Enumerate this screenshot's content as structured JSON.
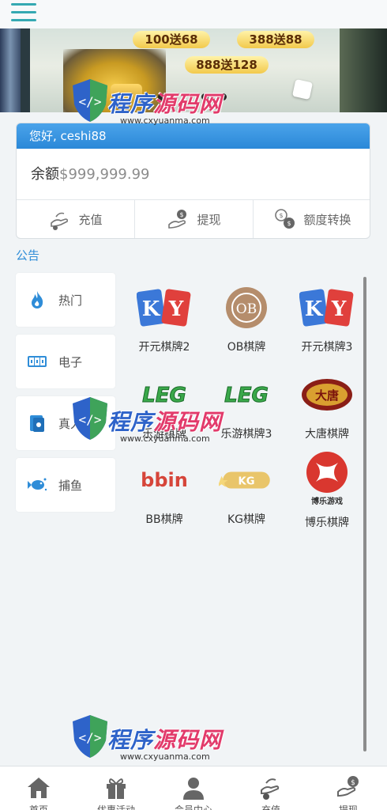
{
  "topbar": {
    "menu_icon": "hamburger-menu-icon"
  },
  "banner": {
    "promos": [
      "100送68",
      "388送88",
      "888送128"
    ],
    "slide_count": 3,
    "active_slide": 1
  },
  "account": {
    "greeting": "您好, ceshi88",
    "balance_label": "余额",
    "balance_value": "$999,999.99",
    "actions": [
      {
        "label": "充值",
        "icon": "deposit-hand-icon"
      },
      {
        "label": "提现",
        "icon": "withdraw-hand-icon"
      },
      {
        "label": "额度转换",
        "icon": "transfer-coins-icon"
      }
    ]
  },
  "notice": {
    "label": "公告"
  },
  "categories": [
    {
      "label": "热门",
      "icon": "flame-icon"
    },
    {
      "label": "电子",
      "icon": "slot-machine-icon"
    },
    {
      "label": "真人",
      "icon": "cards-icon"
    },
    {
      "label": "捕鱼",
      "icon": "fish-icon"
    }
  ],
  "games": [
    {
      "name": "开元棋牌2",
      "logo": "KY"
    },
    {
      "name": "OB棋牌",
      "logo": "OB"
    },
    {
      "name": "开元棋牌3",
      "logo": "KY"
    },
    {
      "name": "乐游棋牌",
      "logo": "LEG"
    },
    {
      "name": "乐游棋牌3",
      "logo": "LEG"
    },
    {
      "name": "大唐棋牌",
      "logo": "大唐棋牌"
    },
    {
      "name": "BB棋牌",
      "logo": "bbin"
    },
    {
      "name": "KG棋牌",
      "logo": "KG"
    },
    {
      "name": "博乐棋牌",
      "logo": "博乐游戏"
    }
  ],
  "bottom_nav": [
    {
      "label": "首页",
      "icon": "home-icon"
    },
    {
      "label": "优惠活动",
      "icon": "gift-icon"
    },
    {
      "label": "会员中心",
      "icon": "user-icon"
    },
    {
      "label": "充值",
      "icon": "deposit-hand-icon"
    },
    {
      "label": "提现",
      "icon": "withdraw-hand-icon"
    }
  ],
  "watermark": {
    "title_a": "程序",
    "title_b": "源码网",
    "url": "www.cxyuanma.com"
  },
  "colors": {
    "accent": "#2b88d8",
    "notice": "#2f8dd8",
    "brand_teal": "#35a9b2"
  }
}
